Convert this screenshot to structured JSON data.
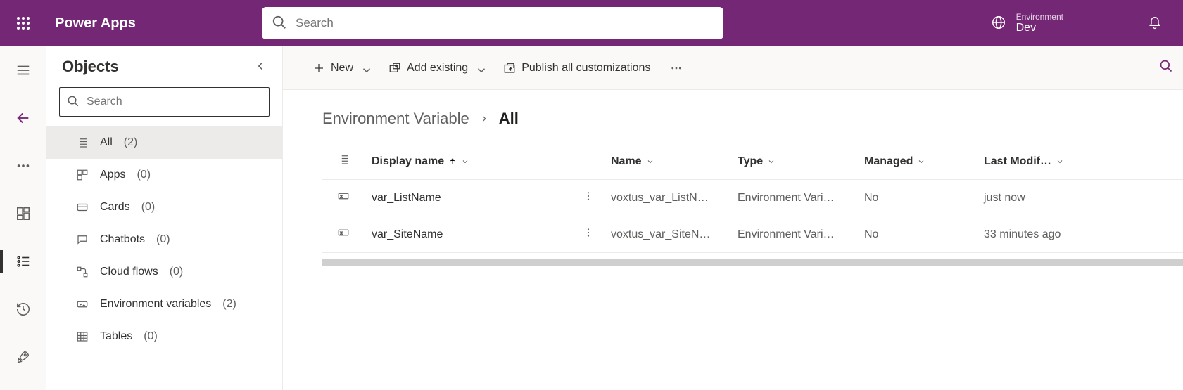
{
  "header": {
    "brand": "Power Apps",
    "search_placeholder": "Search",
    "environment_label": "Environment",
    "environment_value": "Dev"
  },
  "objects_panel": {
    "title": "Objects",
    "search_placeholder": "Search",
    "items": [
      {
        "label": "All",
        "count": "(2)",
        "selected": true
      },
      {
        "label": "Apps",
        "count": "(0)"
      },
      {
        "label": "Cards",
        "count": "(0)"
      },
      {
        "label": "Chatbots",
        "count": "(0)"
      },
      {
        "label": "Cloud flows",
        "count": "(0)"
      },
      {
        "label": "Environment variables",
        "count": "(2)"
      },
      {
        "label": "Tables",
        "count": "(0)"
      }
    ]
  },
  "commands": {
    "new": "New",
    "add_existing": "Add existing",
    "publish": "Publish all customizations"
  },
  "breadcrumb": {
    "root": "Environment Variable",
    "current": "All"
  },
  "table": {
    "headers": {
      "display_name": "Display name",
      "name": "Name",
      "type": "Type",
      "managed": "Managed",
      "modified": "Last Modif…"
    },
    "rows": [
      {
        "display": "var_ListName",
        "name": "voxtus_var_ListN…",
        "type": "Environment Vari…",
        "managed": "No",
        "modified": "just now"
      },
      {
        "display": "var_SiteName",
        "name": "voxtus_var_SiteN…",
        "type": "Environment Vari…",
        "managed": "No",
        "modified": "33 minutes ago"
      }
    ]
  }
}
